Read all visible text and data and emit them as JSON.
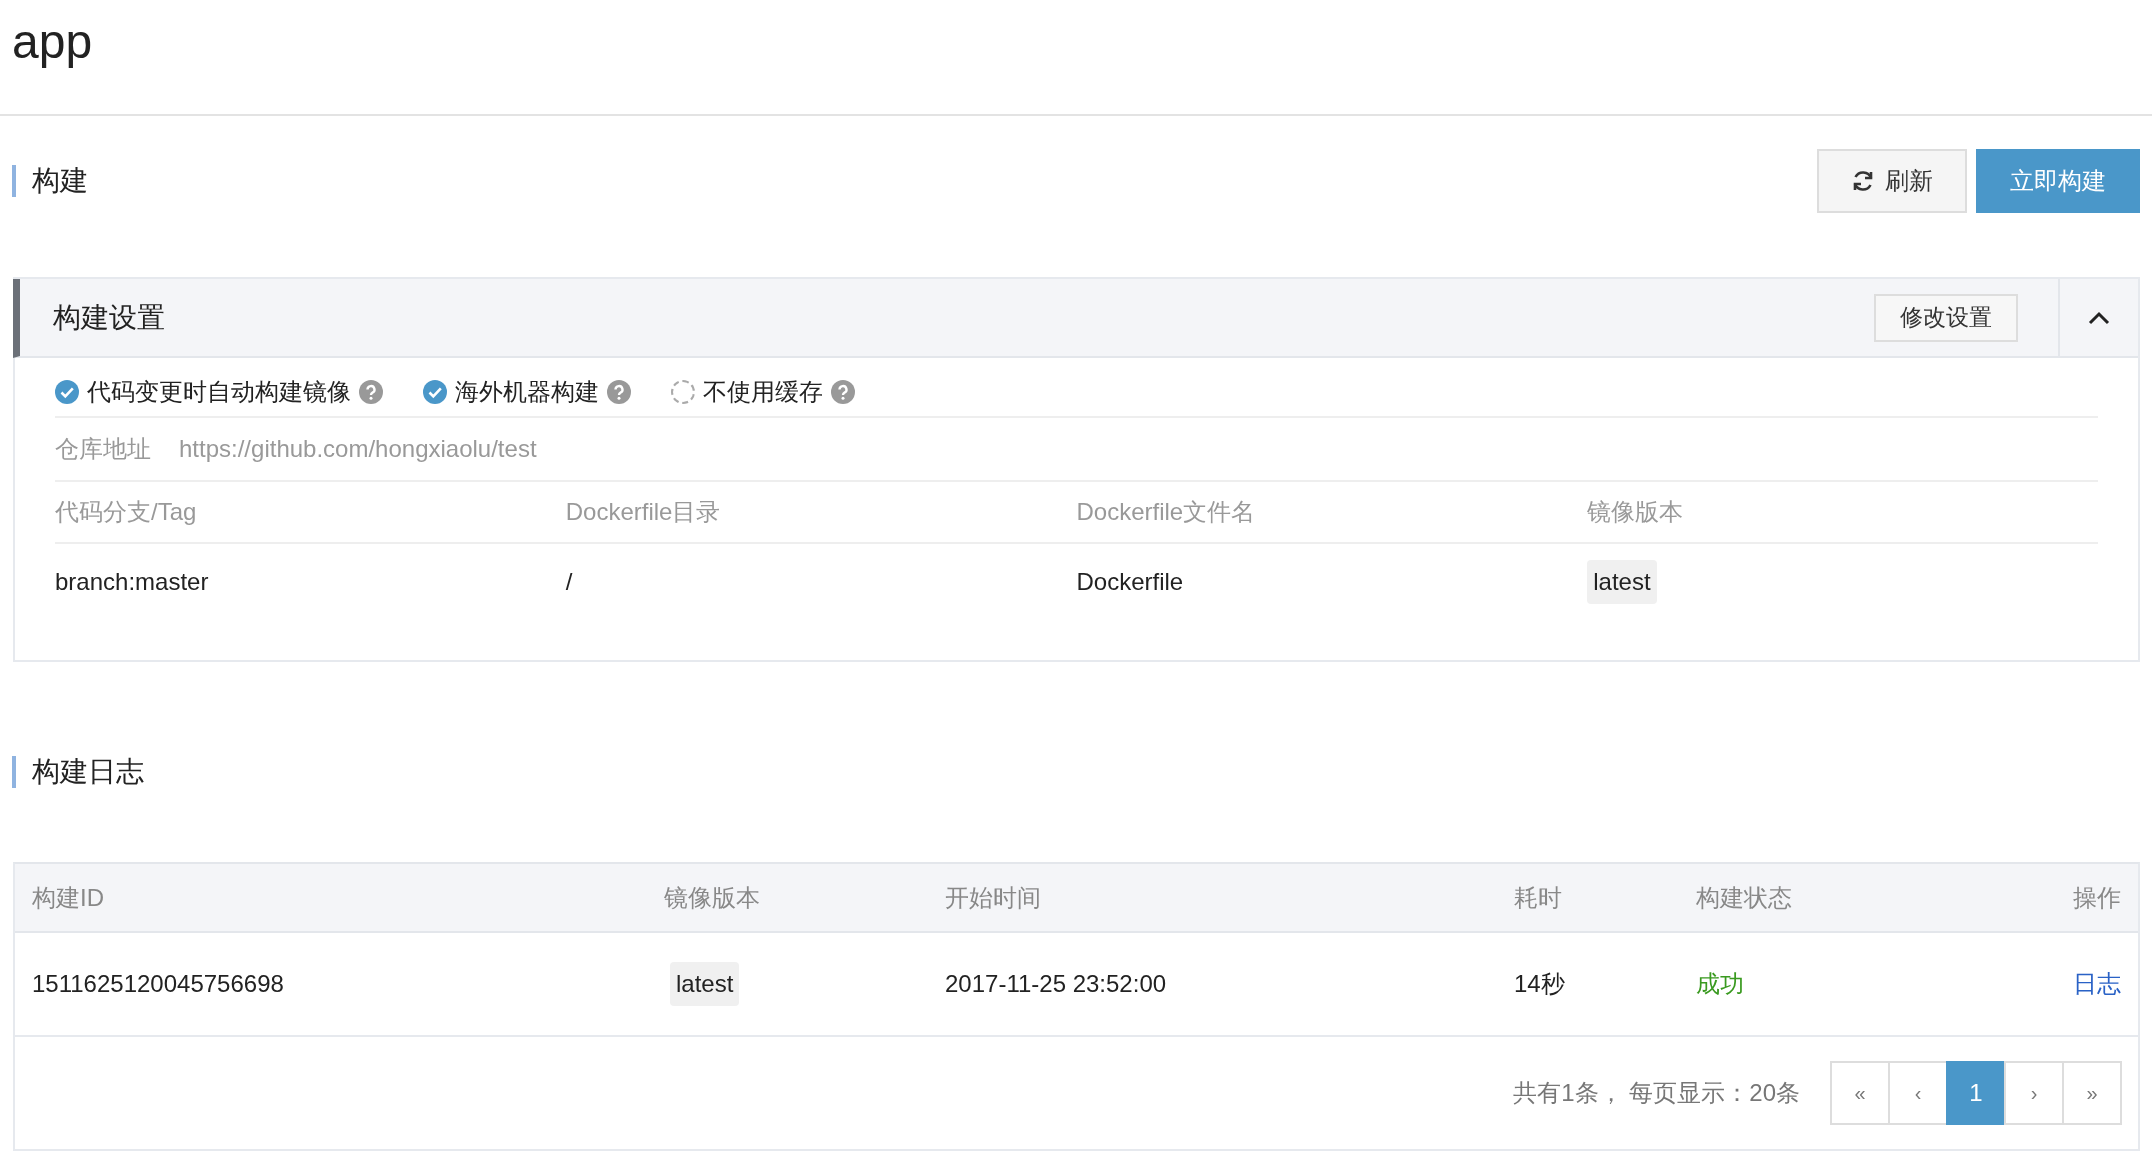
{
  "title": "app",
  "build": {
    "heading": "构建",
    "buttons": [
      {
        "kind": "refresh",
        "label": "刷新"
      },
      {
        "kind": "primary",
        "label": "立即构建"
      }
    ]
  },
  "settings": {
    "title": "构建设置",
    "edit_button": "修改设置",
    "expanded": true,
    "options": [
      {
        "label": "代码变更时自动构建镜像",
        "checked": true
      },
      {
        "label": "海外机器构建",
        "checked": true
      },
      {
        "label": "不使用缓存",
        "checked": false
      }
    ],
    "repo": {
      "label": "仓库地址",
      "value": "https://github.com/hongxiaolu/test"
    },
    "columns": [
      "代码分支/Tag",
      "Dockerfile目录",
      "Dockerfile文件名",
      "镜像版本"
    ],
    "row": [
      {
        "kind": "text",
        "text": "branch:master"
      },
      {
        "kind": "text",
        "text": "/"
      },
      {
        "kind": "text",
        "text": "Dockerfile"
      },
      {
        "kind": "tag",
        "text": "latest"
      }
    ]
  },
  "log": {
    "heading": "构建日志",
    "columns": [
      "构建ID",
      "镜像版本",
      "开始时间",
      "耗时",
      "构建状态",
      "操作"
    ],
    "rows": [
      {
        "cells": [
          {
            "kind": "text",
            "text": "1511625120045756698"
          },
          {
            "kind": "tag",
            "text": "latest"
          },
          {
            "kind": "text",
            "text": "2017-11-25 23:52:00"
          },
          {
            "kind": "text",
            "text": "14秒"
          },
          {
            "kind": "success",
            "text": "成功"
          },
          {
            "kind": "link",
            "text": "日志"
          }
        ]
      }
    ],
    "pagination": {
      "summary": "共有1条， 每页显示：20条",
      "pages": [
        {
          "label": "«",
          "selected": false
        },
        {
          "label": "‹",
          "selected": false
        },
        {
          "label": "1",
          "selected": true
        },
        {
          "label": "›",
          "selected": false
        },
        {
          "label": "»",
          "selected": false
        }
      ]
    }
  }
}
